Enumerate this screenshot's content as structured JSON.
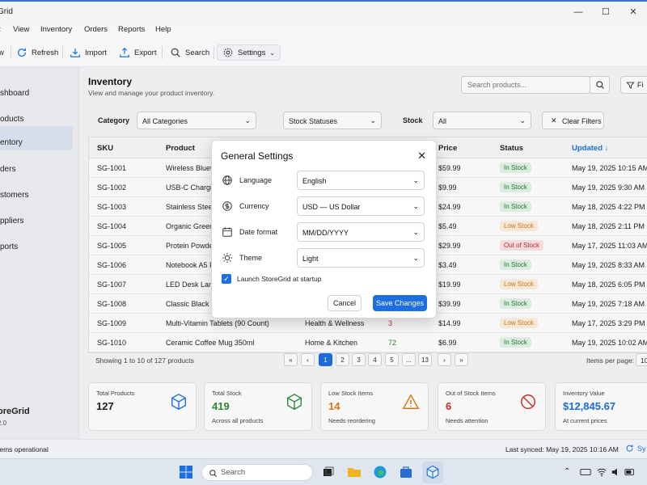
{
  "window": {
    "title": "Grid",
    "minimize": "—",
    "maximize": "☐",
    "close": "✕"
  },
  "menu": [
    "t",
    "View",
    "Inventory",
    "Orders",
    "Reports",
    "Help"
  ],
  "toolbar": {
    "new_label": "w",
    "refresh_label": "Refresh",
    "import_label": "Import",
    "export_label": "Export",
    "search_label": "Search",
    "settings_label": "Settings"
  },
  "sidebar": {
    "items": [
      {
        "label": "shboard"
      },
      {
        "label": "oducts"
      },
      {
        "label": "entory"
      },
      {
        "label": "ders"
      },
      {
        "label": "stomers"
      },
      {
        "label": "ppliers"
      },
      {
        "label": "ports"
      }
    ],
    "brand": "oreGrid",
    "version": "2.0"
  },
  "page": {
    "title": "Inventory",
    "subtitle": "View and manage your product inventory.",
    "search_placeholder": "Search products...",
    "filter_label": "Fi"
  },
  "filters": {
    "category_label": "Category",
    "category_value": "All Categories",
    "stock_status_value": "Stock Statuses",
    "stock_label": "Stock",
    "stock_value": "All",
    "clear_label": "Clear Filters"
  },
  "table": {
    "headers": [
      "SKU",
      "Product",
      "Price",
      "Status",
      "Updated"
    ],
    "rows": [
      {
        "sku": "SG-1001",
        "product": "Wireless Blueto",
        "category": "",
        "qty": "",
        "price": "$59.99",
        "status": "In Stock",
        "status_type": "in",
        "updated": "May 19, 2025 10:15 AM"
      },
      {
        "sku": "SG-1002",
        "product": "USB-C Chargin",
        "category": "",
        "qty": "",
        "price": "$9.99",
        "status": "In Stock",
        "status_type": "in",
        "updated": "May 19, 2025 9:30 AM"
      },
      {
        "sku": "SG-1003",
        "product": "Stainless Steel",
        "category": "",
        "qty": "",
        "price": "$24.99",
        "status": "In Stock",
        "status_type": "in",
        "updated": "May 18, 2025 4:22 PM"
      },
      {
        "sku": "SG-1004",
        "product": "Organic Green",
        "category": "",
        "qty": "",
        "price": "$5.49",
        "status": "Low Stock",
        "status_type": "low",
        "updated": "May 18, 2025 2:11 PM"
      },
      {
        "sku": "SG-1005",
        "product": "Protein Powde",
        "category": "",
        "qty": "",
        "price": "$29.99",
        "status": "Out of Stock",
        "status_type": "out",
        "updated": "May 17, 2025 11:03 AM"
      },
      {
        "sku": "SG-1006",
        "product": "Notebook A5 F",
        "category": "",
        "qty": "",
        "price": "$3.49",
        "status": "In Stock",
        "status_type": "in",
        "updated": "May 19, 2025 8:33 AM"
      },
      {
        "sku": "SG-1007",
        "product": "LED Desk Lamp",
        "category": "",
        "qty": "",
        "price": "$19.99",
        "status": "Low Stock",
        "status_type": "low",
        "updated": "May 18, 2025 6:05 PM"
      },
      {
        "sku": "SG-1008",
        "product": "Classic Black B",
        "category": "",
        "qty": "",
        "price": "$39.99",
        "status": "In Stock",
        "status_type": "in",
        "updated": "May 19, 2025 7:18 AM"
      },
      {
        "sku": "SG-1009",
        "product": "Multi-Vitamin Tablets (90 Count)",
        "category": "Health & Wellness",
        "qty": "3",
        "price": "$14.99",
        "status": "Low Stock",
        "status_type": "low",
        "updated": "May 17, 2025 3:29 PM"
      },
      {
        "sku": "SG-1010",
        "product": "Ceramic Coffee Mug 350ml",
        "category": "Home & Kitchen",
        "qty": "72",
        "price": "$6.99",
        "status": "In Stock",
        "status_type": "in",
        "updated": "May 19, 2025 10:02 AM"
      }
    ]
  },
  "pagination": {
    "info": "Showing 1 to 10 of 127 products",
    "buttons": [
      "«",
      "‹",
      "1",
      "2",
      "3",
      "4",
      "5",
      "...",
      "13",
      "›",
      "»"
    ],
    "per_page_label": "Items per page:",
    "per_page_value": "10"
  },
  "cards": [
    {
      "label": "Total Products",
      "value": "127",
      "sub": "",
      "color": "#222222",
      "icon": "cube-icon"
    },
    {
      "label": "Total Stock",
      "value": "419",
      "sub": "Across all products",
      "color": "#2e8b3a",
      "icon": "box-icon"
    },
    {
      "label": "Low Stock Items",
      "value": "14",
      "sub": "Needs reordering",
      "color": "#e07b10",
      "icon": "warning-icon"
    },
    {
      "label": "Out of Stock Items",
      "value": "6",
      "sub": "Needs attention",
      "color": "#d32f2f",
      "icon": "blocked-icon"
    },
    {
      "label": "Inventory Value",
      "value": "$12,845.67",
      "sub": "At current prices",
      "color": "#1d6fe0",
      "icon": "value-icon"
    }
  ],
  "status": {
    "left": "tems operational",
    "right": "Last synced: May 19, 2025 10:16 AM",
    "sync": "Sy"
  },
  "modal": {
    "title": "General Settings",
    "rows": [
      {
        "label": "Language",
        "value": "English",
        "icon": "globe-icon"
      },
      {
        "label": "Currency",
        "value": "USD — US Dollar",
        "icon": "dollar-icon"
      },
      {
        "label": "Date format",
        "value": "MM/DD/YYYY",
        "icon": "calendar-icon"
      },
      {
        "label": "Theme",
        "value": "Light",
        "icon": "sun-icon"
      }
    ],
    "checkbox_label": "Launch StoreGrid at startup",
    "checkbox_checked": true,
    "cancel_label": "Cancel",
    "save_label": "Save Changes"
  },
  "taskbar": {
    "search_placeholder": "Search"
  }
}
